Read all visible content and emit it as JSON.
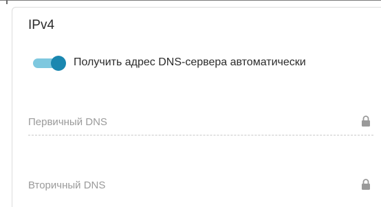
{
  "ipv4": {
    "title": "IPv4",
    "dns_auto": {
      "label": "Получить адрес DNS-сервера автоматически",
      "enabled": true,
      "track_color": "#7ec8df",
      "knob_color": "#1a87b0"
    },
    "primary_dns": {
      "placeholder": "Первичный DNS",
      "value": "",
      "locked": true,
      "icon": "lock-icon"
    },
    "secondary_dns": {
      "placeholder": "Вторичный DNS",
      "value": "",
      "locked": true,
      "icon": "lock-icon"
    }
  }
}
